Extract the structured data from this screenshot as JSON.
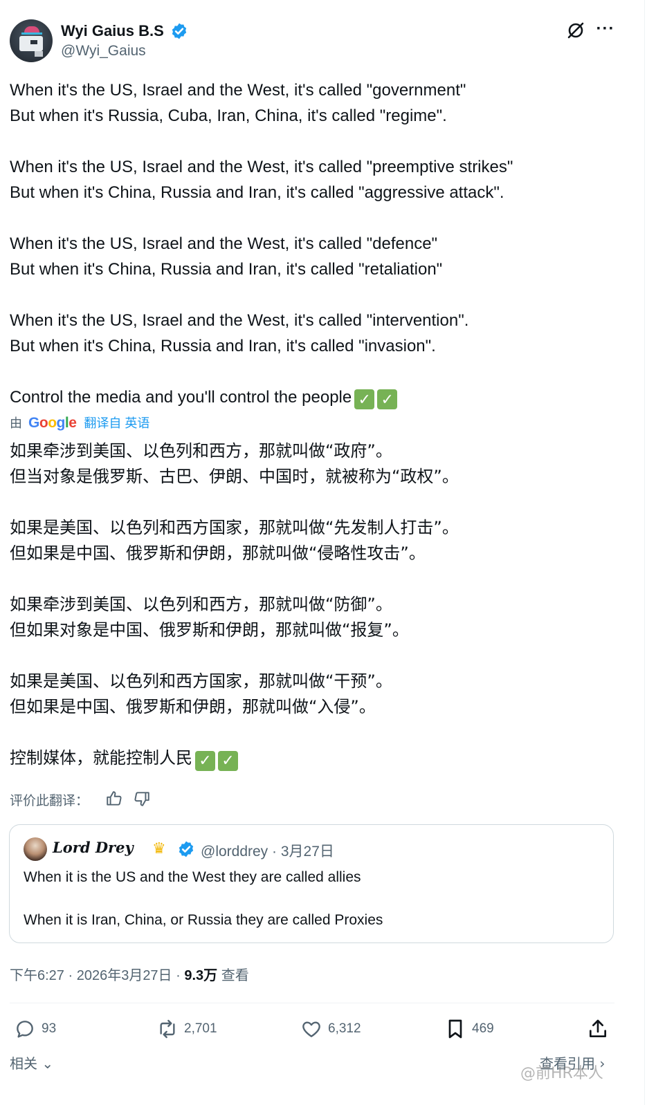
{
  "author": {
    "display_name": "Wyi Gaius B.S",
    "handle": "@Wyi_Gaius"
  },
  "post_en": [
    "When it's the US, Israel and the West, it's called \"government\"",
    "But when it's Russia, Cuba, Iran, China, it's called \"regime\".",
    "",
    "When it's the US, Israel and the West, it's called \"preemptive strikes\"",
    "But when it's China, Russia and Iran, it's called \"aggressive attack\".",
    "",
    "When it's the US, Israel and the West, it's called \"defence\"",
    "But when it's China, Russia and Iran, it's called \"retaliation\"",
    "",
    "When it's the US, Israel and the West, it's called \"intervention\".",
    "But when it's China, Russia and Iran, it's called \"invasion\".",
    ""
  ],
  "post_en_last": "Control the media and you'll control the people",
  "translation": {
    "by": "由",
    "google": [
      "G",
      "o",
      "o",
      "g",
      "l",
      "e"
    ],
    "translated_from": "翻译自 英语"
  },
  "post_zh": [
    "如果牵涉到美国、以色列和西方，那就叫做“政府”。",
    "但当对象是俄罗斯、古巴、伊朗、中国时，就被称为“政权”。",
    "",
    "如果是美国、以色列和西方国家，那就叫做“先发制人打击”。",
    "但如果是中国、俄罗斯和伊朗，那就叫做“侵略性攻击”。",
    "",
    "如果牵涉到美国、以色列和西方，那就叫做“防御”。",
    "但如果对象是中国、俄罗斯和伊朗，那就叫做“报复”。",
    "",
    "如果是美国、以色列和西方国家，那就叫做“干预”。",
    "但如果是中国、俄罗斯和伊朗，那就叫做“入侵”。",
    ""
  ],
  "post_zh_last": "控制媒体，就能控制人民",
  "check_mark": "✓",
  "rate_label": "评价此翻译：",
  "quote": {
    "name": "Lord Drey",
    "crown": "♛",
    "meta": "@lorddrey · 3月27日",
    "text1": "When it is the US and the West they are called allies",
    "text2": "When it is Iran, China, or Russia they are called Proxies"
  },
  "timestamp": {
    "time": "下午6:27 · 2026年3月27日 · ",
    "views": "9.3万",
    "views_label": " 查看"
  },
  "actions": {
    "replies": "93",
    "retweets": "2,701",
    "likes": "6,312",
    "bookmarks": "469"
  },
  "related": "相关",
  "view_quotes": "查看引用",
  "watermark": "@前HR本人",
  "colors": {
    "accent": "#1d9bf0",
    "secondary_text": "#536471",
    "check_green": "#77b255"
  }
}
